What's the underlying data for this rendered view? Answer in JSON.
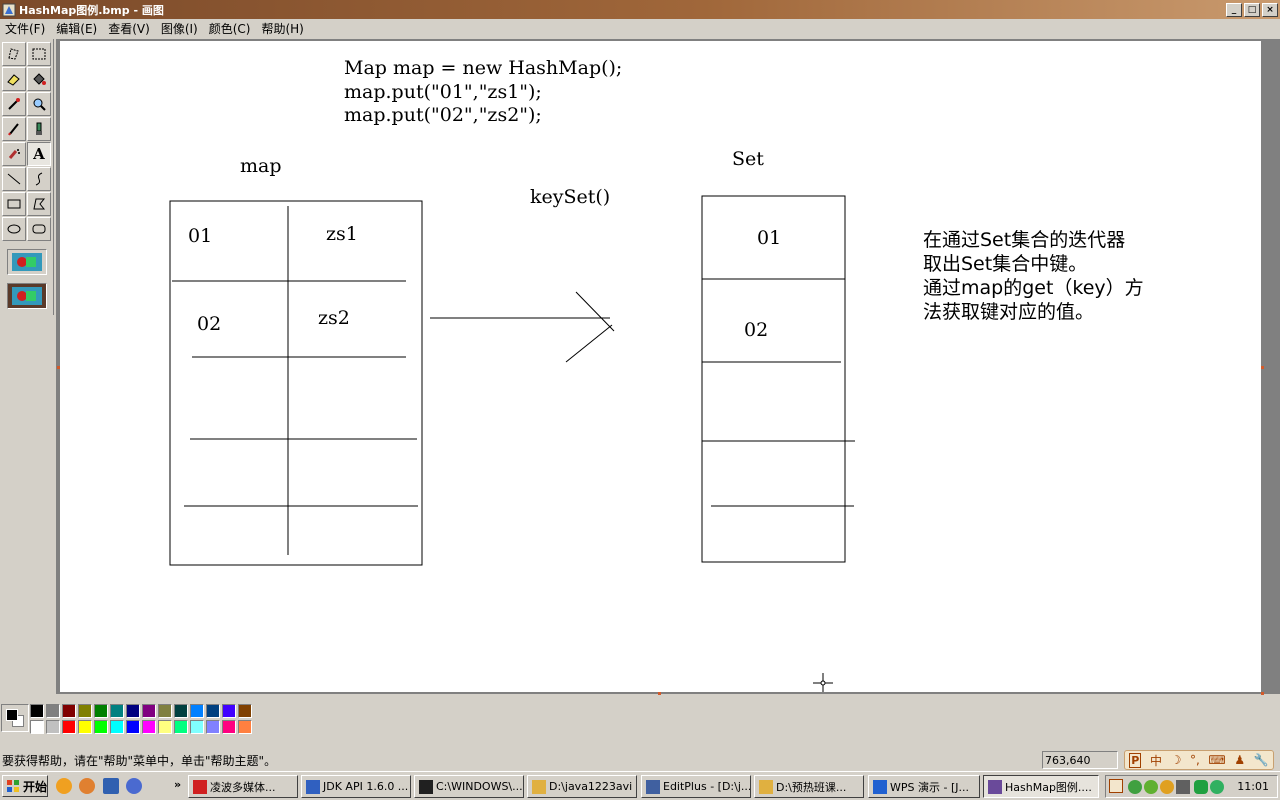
{
  "window": {
    "title": "HashMap图例.bmp - 画图",
    "buttons": {
      "minimize": "_",
      "maximize": "□",
      "close": "×"
    }
  },
  "menu": [
    "文件(F)",
    "编辑(E)",
    "查看(V)",
    "图像(I)",
    "颜色(C)",
    "帮助(H)"
  ],
  "tools": [
    {
      "name": "free-form-select-icon"
    },
    {
      "name": "select-icon"
    },
    {
      "name": "eraser-icon"
    },
    {
      "name": "fill-icon"
    },
    {
      "name": "color-picker-icon"
    },
    {
      "name": "magnifier-icon"
    },
    {
      "name": "pencil-icon"
    },
    {
      "name": "brush-icon"
    },
    {
      "name": "airbrush-icon"
    },
    {
      "name": "text-icon",
      "label": "A",
      "selected": true
    },
    {
      "name": "line-icon"
    },
    {
      "name": "curve-icon"
    },
    {
      "name": "rectangle-icon"
    },
    {
      "name": "polygon-icon"
    },
    {
      "name": "ellipse-icon"
    },
    {
      "name": "rounded-rectangle-icon"
    }
  ],
  "drawing": {
    "code_lines": [
      "Map map = new HashMap();",
      "map.put(\"01\",\"zs1\");",
      "map.put(\"02\",\"zs2\");"
    ],
    "map_label": "map",
    "map_rows": [
      {
        "key": "01",
        "value": "zs1"
      },
      {
        "key": "02",
        "value": "zs2"
      }
    ],
    "method_label": "keySet()",
    "set_label": "Set",
    "set_rows": [
      "01",
      "02"
    ],
    "note_lines": [
      "在通过Set集合的迭代器",
      "取出Set集合中键。",
      "通过map的get（key）方",
      "法获取键对应的值。"
    ]
  },
  "palette": {
    "foreground": "#000000",
    "background": "#ffffff",
    "top_row": [
      "#000000",
      "#808080",
      "#800000",
      "#808000",
      "#008000",
      "#008080",
      "#000080",
      "#800080",
      "#808040",
      "#004040",
      "#0080ff",
      "#004080",
      "#4000ff",
      "#804000"
    ],
    "bottom_row": [
      "#ffffff",
      "#c0c0c0",
      "#ff0000",
      "#ffff00",
      "#00ff00",
      "#00ffff",
      "#0000ff",
      "#ff00ff",
      "#ffff80",
      "#00ff80",
      "#80ffff",
      "#8080ff",
      "#ff0080",
      "#ff8040"
    ]
  },
  "statusbar": {
    "help_text": "要获得帮助，请在\"帮助\"菜单中，单击\"帮助主题\"。",
    "coordinates": "763,640",
    "ime": [
      "中",
      "☽",
      "°,",
      "⌨",
      "♟",
      "🔧"
    ]
  },
  "taskbar": {
    "start_label": "开始",
    "tasks": [
      {
        "label": "凌波多媒体...",
        "color": "#d02020"
      },
      {
        "label": "JDK API 1.6.0 ...",
        "color": "#3060c0"
      },
      {
        "label": "C:\\WINDOWS\\...",
        "color": "#202020"
      },
      {
        "label": "D:\\java1223avi",
        "color": "#e0b040"
      },
      {
        "label": "EditPlus - [D:\\j...",
        "color": "#4060a0"
      },
      {
        "label": "D:\\预热班课...",
        "color": "#e0b040"
      },
      {
        "label": "WPS 演示 - [J...",
        "color": "#2060d0"
      },
      {
        "label": "HashMap图例....",
        "color": "#6a4a9a",
        "active": true
      }
    ],
    "clock": "11:01"
  }
}
